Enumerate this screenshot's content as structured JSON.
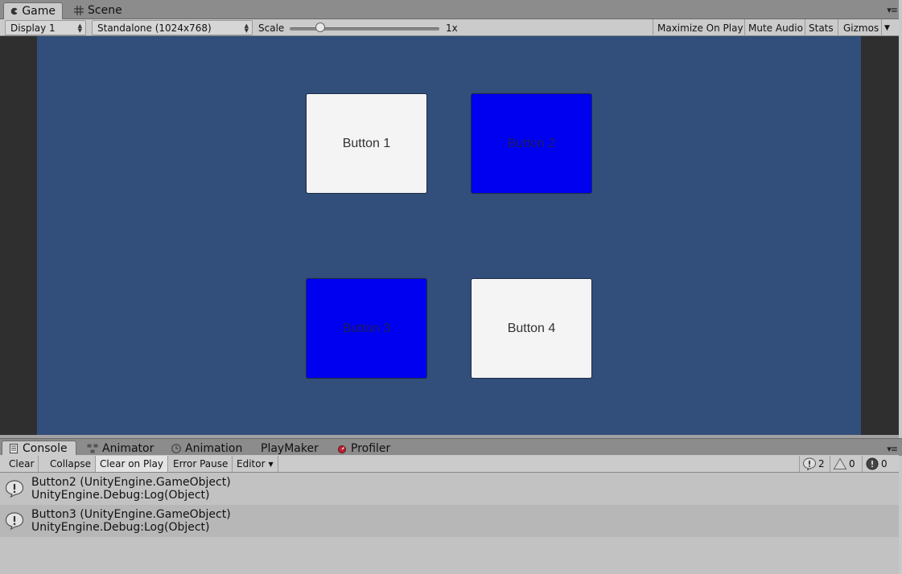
{
  "top_tabs": [
    {
      "label": "Game",
      "icon": "pacman-icon",
      "active": true
    },
    {
      "label": "Scene",
      "icon": "grid-icon",
      "active": false
    }
  ],
  "game_toolbar": {
    "display": "Display 1",
    "resolution": "Standalone (1024x768)",
    "scale_label": "Scale",
    "scale_value": "1x",
    "scale_level": 0.17,
    "maximize": "Maximize On Play",
    "mute": "Mute Audio",
    "stats": "Stats",
    "gizmos": "Gizmos"
  },
  "game": {
    "buttons": [
      {
        "label": "Button 1",
        "color": "#f4f4f4"
      },
      {
        "label": "Button 2",
        "color": "#0000f0"
      },
      {
        "label": "Button 3",
        "color": "#0000f0"
      },
      {
        "label": "Button 4",
        "color": "#f4f4f4"
      }
    ],
    "background": "#324e7a"
  },
  "console_tabs": [
    {
      "label": "Console",
      "icon": "console-icon",
      "active": true
    },
    {
      "label": "Animator",
      "icon": "animator-icon",
      "active": false
    },
    {
      "label": "Animation",
      "icon": "clock-icon",
      "active": false
    },
    {
      "label": "PlayMaker",
      "icon": "",
      "active": false
    },
    {
      "label": "Profiler",
      "icon": "profiler-icon",
      "active": false
    }
  ],
  "console_toolbar": {
    "clear": "Clear",
    "collapse": "Collapse",
    "clear_on_play": "Clear on Play",
    "error_pause": "Error Pause",
    "editor": "Editor",
    "info_count": "2",
    "warning_count": "0",
    "error_count": "0"
  },
  "logs": [
    {
      "line1": "Button2 (UnityEngine.GameObject)",
      "line2": "UnityEngine.Debug:Log(Object)"
    },
    {
      "line1": "Button3 (UnityEngine.GameObject)",
      "line2": "UnityEngine.Debug:Log(Object)"
    }
  ]
}
